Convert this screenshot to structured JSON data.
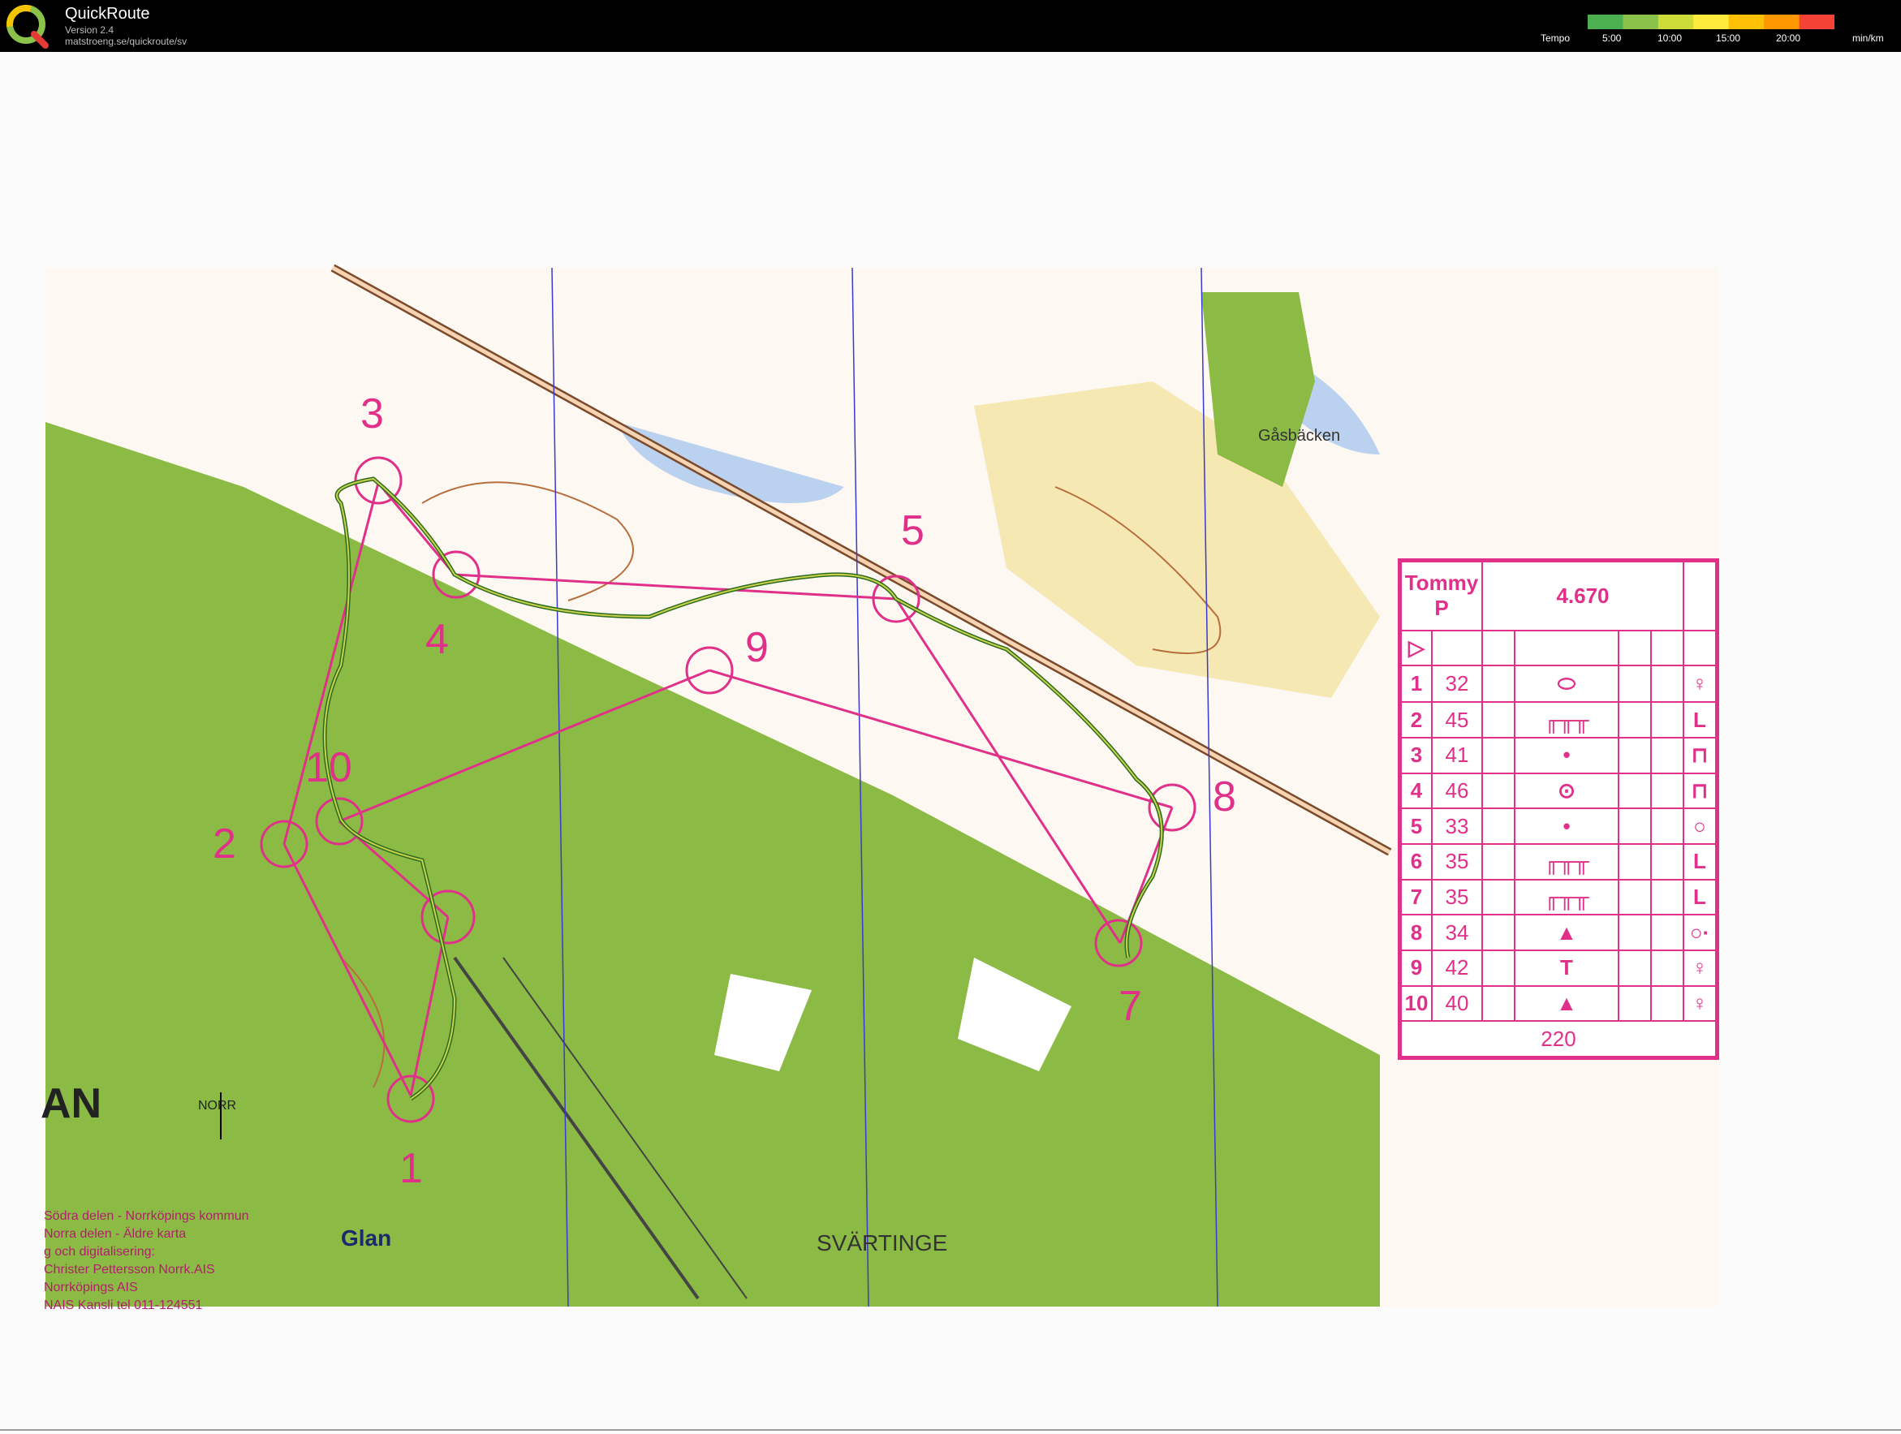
{
  "app": {
    "title": "QuickRoute",
    "version": "Version 2.4",
    "url": "matstroeng.se/quickroute/sv"
  },
  "tempo_legend": {
    "label": "Tempo",
    "ticks": [
      "5:00",
      "10:00",
      "15:00",
      "20:00"
    ],
    "unit": "min/km",
    "colors": [
      "#4caf50",
      "#8bc34a",
      "#cddc39",
      "#ffeb3b",
      "#ffc107",
      "#ff9800",
      "#f44336"
    ]
  },
  "map": {
    "colors": {
      "forest": "#8cbb45",
      "water": "#3b6fd6",
      "course": "#e0308a",
      "route": "#2e6b1f",
      "contour": "#b86e3c",
      "yellow": "#f3e3a2"
    },
    "place_names": {
      "gasbacken": "Gåsbäcken",
      "svartinge": "SVÄRTINGE",
      "glan": "Glan",
      "an": "AN",
      "norr": "NORR"
    },
    "control_numbers": [
      "1",
      "2",
      "3",
      "4",
      "5",
      "7",
      "8",
      "9",
      "10"
    ],
    "credits": [
      "Södra delen - Norrköpings kommun",
      "Norra delen - Äldre karta",
      "g och digitalisering:",
      "Christer Pettersson Norrk.AIS",
      "Norrköpings AIS",
      "NAIS Kansli tel 011-124551"
    ]
  },
  "descriptions": {
    "name": "Tommy P",
    "length": "4.670",
    "start_symbol": "▷",
    "finish_distance": "220",
    "controls": [
      {
        "num": "1",
        "code": "32",
        "feature": "⬭",
        "detail": "♀"
      },
      {
        "num": "2",
        "code": "45",
        "feature": "╓╥╥",
        "detail": "L"
      },
      {
        "num": "3",
        "code": "41",
        "feature": "•",
        "detail": "⊓"
      },
      {
        "num": "4",
        "code": "46",
        "feature": "⊙",
        "detail": "⊓"
      },
      {
        "num": "5",
        "code": "33",
        "feature": "•",
        "detail": "○"
      },
      {
        "num": "6",
        "code": "35",
        "feature": "╓╥╥",
        "detail": "L"
      },
      {
        "num": "7",
        "code": "35",
        "feature": "╓╥╥",
        "detail": "L"
      },
      {
        "num": "8",
        "code": "34",
        "feature": "▲",
        "detail": "○·"
      },
      {
        "num": "9",
        "code": "42",
        "feature": "T",
        "detail": "♀"
      },
      {
        "num": "10",
        "code": "40",
        "feature": "▲",
        "detail": "♀"
      }
    ]
  }
}
